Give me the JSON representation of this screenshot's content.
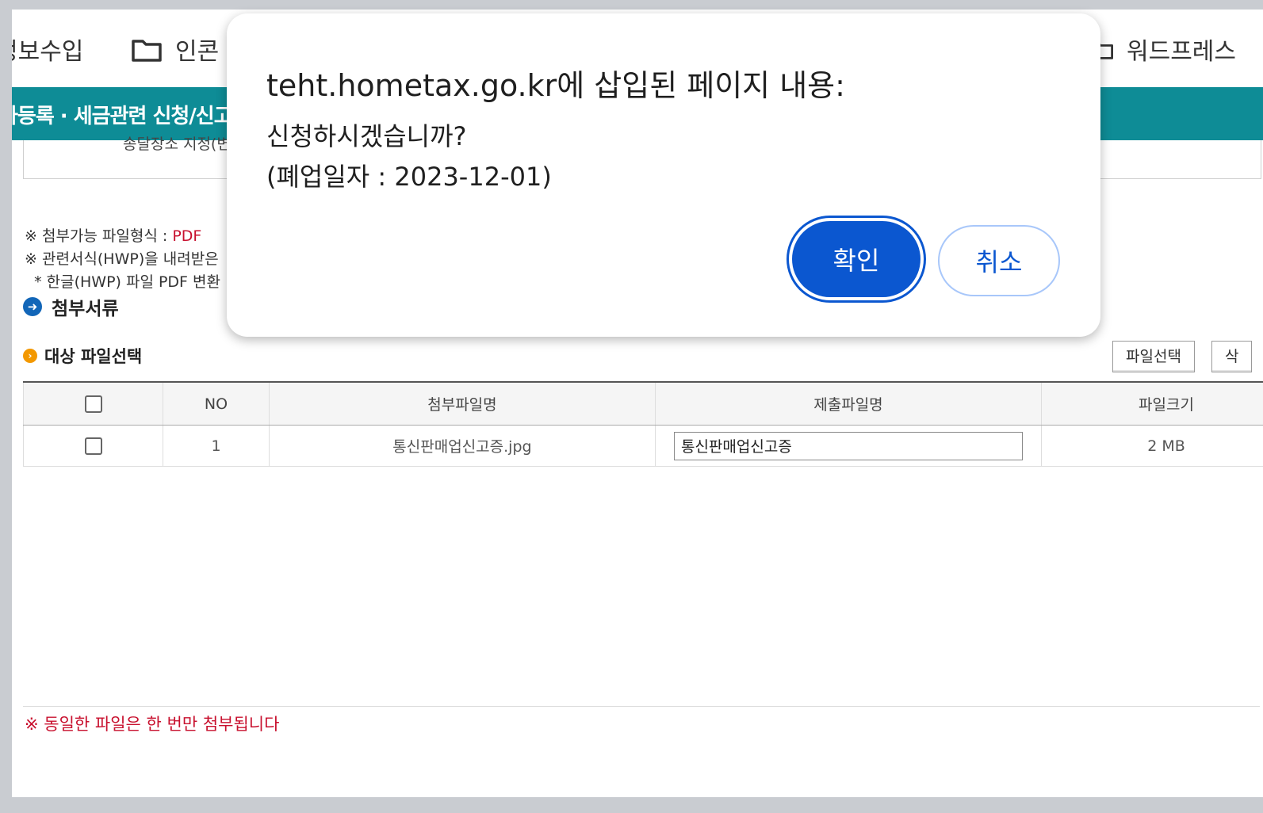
{
  "bookmarks": {
    "item1": "정보수입",
    "item2": "인콘",
    "item3": "워드프레스",
    "folder_icon": "folder-icon"
  },
  "banner": {
    "title": "자등록 · 세금관련 신청/신고"
  },
  "prev_box": {
    "text": "송달장소 지정(변"
  },
  "notes": {
    "line1_prefix": "※ 첨부가능 파일형식 : ",
    "line1_red": "PDF",
    "line2": "※ 관련서식(HWP)을 내려받은",
    "line3": "  * 한글(HWP) 파일 PDF 변환"
  },
  "section": {
    "title": "첨부서류"
  },
  "file_select": {
    "title": "대상 파일선택",
    "select_button": "파일선택",
    "delete_button": "삭"
  },
  "table": {
    "headers": {
      "no": "NO",
      "attach_name": "첨부파일명",
      "submit_name": "제출파일명",
      "size": "파일크기"
    },
    "rows": [
      {
        "no": "1",
        "attach_name": "통신판매업신고증.jpg",
        "submit_name": "통신판매업신고증",
        "size": "2 MB"
      }
    ]
  },
  "warning": "※ 동일한 파일은 한 번만 첨부됩니다",
  "dialog": {
    "title": "teht.hometax.go.kr에 삽입된 페이지 내용:",
    "message_line1": "신청하시겠습니까?",
    "message_line2": "(폐업일자 : 2023-12-01)",
    "ok_label": "확인",
    "cancel_label": "취소"
  },
  "colors": {
    "accent": "#0b57d0",
    "banner": "#0e8c96",
    "warning": "#c8102e"
  }
}
